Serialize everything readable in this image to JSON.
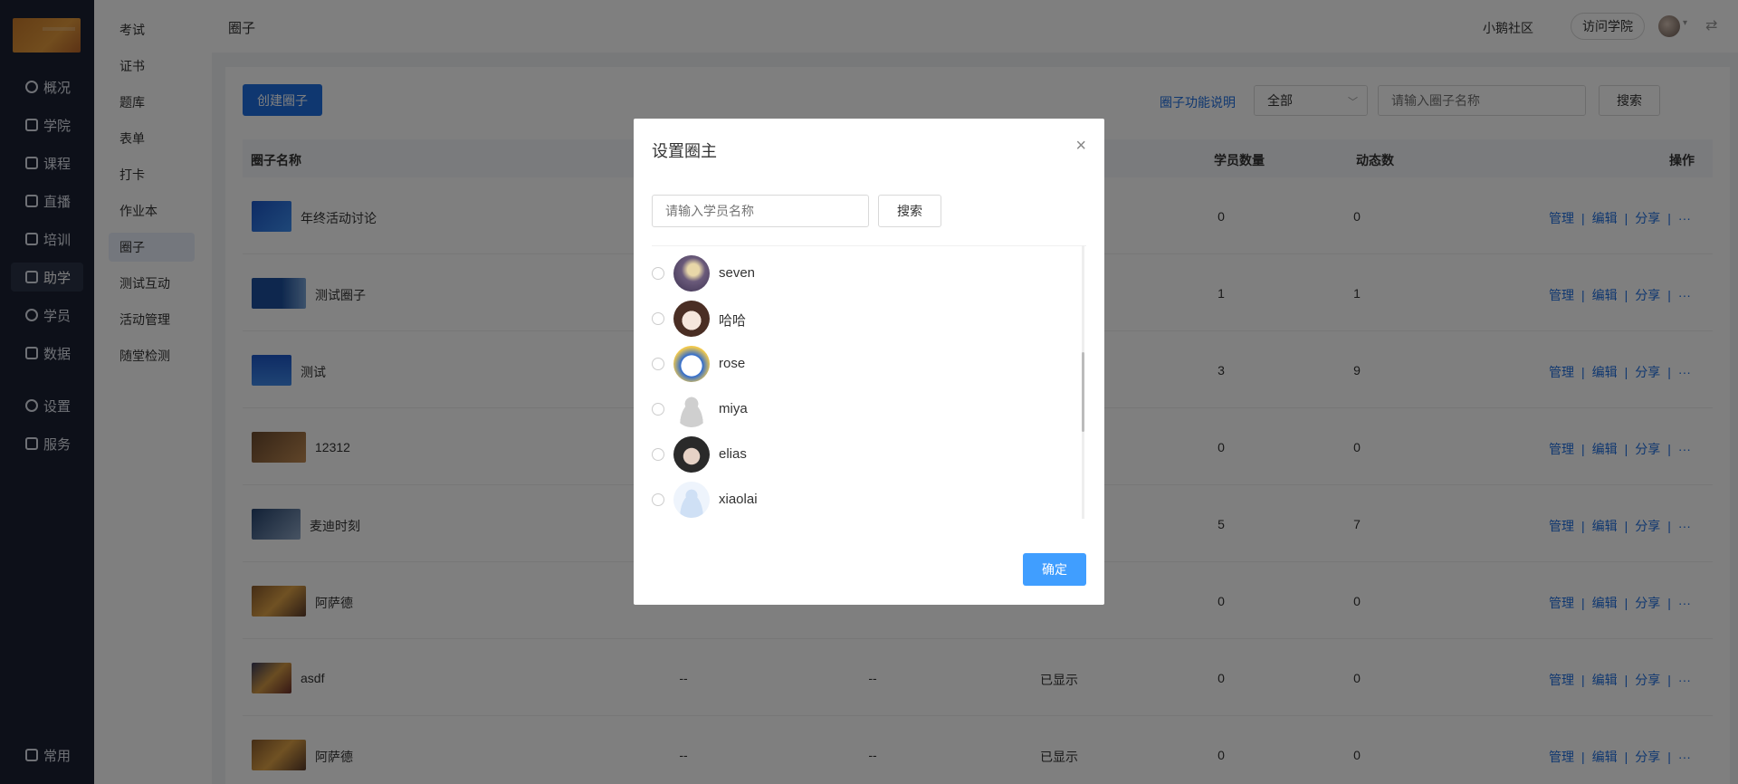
{
  "nav": {
    "items": [
      {
        "label": "概况",
        "icon": "pie-chart-icon"
      },
      {
        "label": "学院",
        "icon": "school-icon"
      },
      {
        "label": "课程",
        "icon": "book-icon"
      },
      {
        "label": "直播",
        "icon": "live-icon"
      },
      {
        "label": "培训",
        "icon": "training-icon"
      },
      {
        "label": "助学",
        "icon": "assist-icon"
      },
      {
        "label": "学员",
        "icon": "user-icon"
      },
      {
        "label": "数据",
        "icon": "data-icon"
      },
      {
        "label": "设置",
        "icon": "gear-icon"
      },
      {
        "label": "服务",
        "icon": "service-icon"
      }
    ],
    "bottom_label": "常用",
    "active": "助学"
  },
  "subnav": {
    "items": [
      "考试",
      "证书",
      "题库",
      "表单",
      "打卡",
      "作业本",
      "圈子",
      "测试互动",
      "活动管理",
      "随堂检测"
    ],
    "active": "圈子"
  },
  "header": {
    "title": "圈子",
    "community": "小鹅社区",
    "visit_button": "访问学院",
    "caret": "▾",
    "switch_icon": "⇄"
  },
  "toolbar": {
    "create_button": "创建圈子",
    "desc_link": "圈子功能说明",
    "filter_selected": "全部",
    "search_placeholder": "请输入圈子名称",
    "search_button": "搜索"
  },
  "table": {
    "headers": {
      "name": "圈子名称",
      "members": "学员数量",
      "posts": "动态数",
      "ops": "操作"
    },
    "rows": [
      {
        "name": "年终活动讨论",
        "c1": "",
        "c2": "",
        "status": "",
        "members": "0",
        "posts": "0"
      },
      {
        "name": "测试圈子",
        "c1": "",
        "c2": "",
        "status": "",
        "members": "1",
        "posts": "1"
      },
      {
        "name": "测试",
        "c1": "",
        "c2": "",
        "status": "",
        "members": "3",
        "posts": "9"
      },
      {
        "name": "12312",
        "c1": "",
        "c2": "",
        "status": "",
        "members": "0",
        "posts": "0"
      },
      {
        "name": "麦迪时刻",
        "c1": "",
        "c2": "",
        "status": "",
        "members": "5",
        "posts": "7"
      },
      {
        "name": "阿萨德",
        "c1": "",
        "c2": "",
        "status": "",
        "members": "0",
        "posts": "0"
      },
      {
        "name": "asdf",
        "c1": "--",
        "c2": "--",
        "status": "已显示",
        "members": "0",
        "posts": "0"
      },
      {
        "name": "阿萨德",
        "c1": "--",
        "c2": "--",
        "status": "已显示",
        "members": "0",
        "posts": "0"
      }
    ],
    "ops": {
      "manage": "管理",
      "edit": "编辑",
      "share": "分享",
      "more": "···",
      "sep": "|"
    }
  },
  "modal": {
    "title": "设置圈主",
    "close": "×",
    "search_placeholder": "请输入学员名称",
    "search_button": "搜索",
    "members": [
      "seven",
      "哈哈",
      "rose",
      "miya",
      "elias",
      "xiaolai"
    ],
    "confirm_button": "确定"
  }
}
